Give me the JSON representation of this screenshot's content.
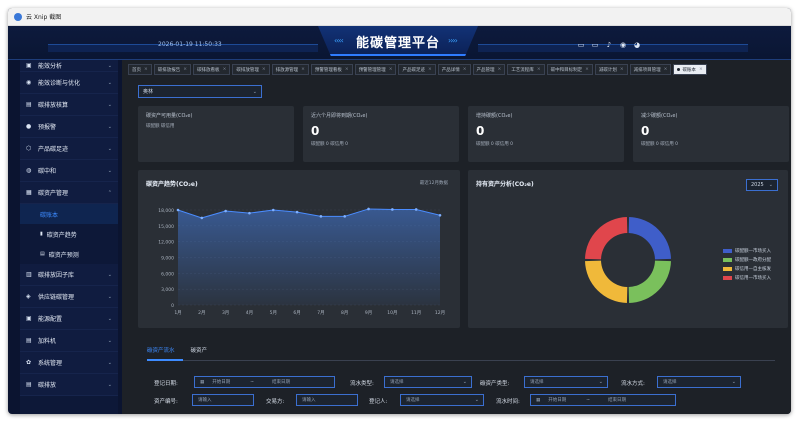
{
  "window": {
    "title": "云 Xnip 截图"
  },
  "header": {
    "date": "2026-01-19 11:50:33",
    "title": "能碳管理平台",
    "left_arrows": "‹‹‹‹",
    "right_arrows": "››››"
  },
  "header_icons": [
    "monitor-icon",
    "desktop-icon",
    "bell-icon",
    "badge-icon",
    "avatar"
  ],
  "sidebar": {
    "items": [
      {
        "label": "能效分析",
        "icon": "▣",
        "chev": "⌄"
      },
      {
        "label": "能效诊断与优化",
        "icon": "◉",
        "chev": "⌄"
      },
      {
        "label": "碳排放核算",
        "icon": "▤",
        "chev": "⌄"
      },
      {
        "label": "预报警",
        "icon": "●",
        "chev": "⌄"
      },
      {
        "label": "产品碳足迹",
        "icon": "⬡",
        "chev": "⌄"
      },
      {
        "label": "碳中和",
        "icon": "◍",
        "chev": "⌄"
      },
      {
        "label": "碳资产管理",
        "icon": "▦",
        "chev": "⌃"
      }
    ],
    "subitems": [
      {
        "label": "碳账本",
        "icon": ""
      },
      {
        "label": "碳资产趋势",
        "icon": "▮"
      },
      {
        "label": "碳资产预测",
        "icon": "▤"
      }
    ],
    "items_after": [
      {
        "label": "碳排放因子库",
        "icon": "▥",
        "chev": "⌄"
      },
      {
        "label": "供应链碳管理",
        "icon": "◈",
        "chev": "⌄"
      },
      {
        "label": "能源配置",
        "icon": "▣",
        "chev": "⌄"
      },
      {
        "label": "加料机",
        "icon": "▤",
        "chev": "⌄"
      },
      {
        "label": "系统管理",
        "icon": "✿",
        "chev": "⌄"
      },
      {
        "label": "碳排放",
        "icon": "▤",
        "chev": "⌄"
      }
    ]
  },
  "tabs": [
    {
      "label": "首页"
    },
    {
      "label": "碳排放报告"
    },
    {
      "label": "碳排放看板"
    },
    {
      "label": "碳排放管理"
    },
    {
      "label": "排放源管理"
    },
    {
      "label": "预警管理看板"
    },
    {
      "label": "预警管理管理"
    },
    {
      "label": "产品碳足迹"
    },
    {
      "label": "产品详情"
    },
    {
      "label": "产品管理"
    },
    {
      "label": "工艺流程库"
    },
    {
      "label": "碳中和目标制定"
    },
    {
      "label": "减碳计划"
    },
    {
      "label": "减排项目管理"
    },
    {
      "label": "碳账本",
      "active": true
    }
  ],
  "company_select": {
    "value": "奥林"
  },
  "cards": [
    {
      "label": "碳资产可用量(CO₂e)",
      "value": "",
      "sub": "碳配额    碳信用"
    },
    {
      "label": "近六个月即将到期(CO₂e)",
      "value": "0",
      "sub": "碳配额 0    碳信用 0"
    },
    {
      "label": "增持碳额(CO₂e)",
      "value": "0",
      "sub": "碳配额 0    碳信用 0"
    },
    {
      "label": "减少碳额(CO₂e)",
      "value": "0",
      "sub": "碳配额 0    碳信用 0"
    }
  ],
  "trend_panel": {
    "title": "碳资产趋势(CO₂e)",
    "subtitle": "最近12月数据"
  },
  "pie_panel": {
    "title": "持有资产分析(CO₂e)",
    "year": "2025"
  },
  "chart_data": [
    {
      "type": "area",
      "x": [
        "1月",
        "2月",
        "3月",
        "4月",
        "5月",
        "6月",
        "7月",
        "8月",
        "9月",
        "10月",
        "11月",
        "12月"
      ],
      "series": [
        {
          "values": [
            18000,
            16500,
            17800,
            17400,
            18000,
            17600,
            16800,
            16800,
            18200,
            18100,
            18100,
            17000
          ]
        }
      ],
      "yticks": [
        "0",
        "3,000",
        "6,000",
        "9,000",
        "12,000",
        "15,000",
        "18,000"
      ],
      "ylim": [
        0,
        18000
      ],
      "grid": true,
      "color": "#4a8cff"
    },
    {
      "type": "pie",
      "slices": [
        {
          "name": "碳配额—市场买入",
          "value": 25,
          "color": "#3f5ec9"
        },
        {
          "name": "碳配额—政府分配",
          "value": 25,
          "color": "#7ac05c"
        },
        {
          "name": "碳信用—自主核发",
          "value": 25,
          "color": "#f0b93a"
        },
        {
          "name": "碳信用—市场买入",
          "value": 25,
          "color": "#e0464c"
        }
      ],
      "legend": "right"
    }
  ],
  "bottom_tabs": [
    {
      "label": "碳资产流水",
      "active": true
    },
    {
      "label": "碳资产"
    }
  ],
  "form": {
    "reg_date_label": "登记日期:",
    "start_date": "开始日期",
    "tilde": "~",
    "end_date": "结束日期",
    "flow_type_label": "流水类型:",
    "flow_type_ph": "请选择",
    "asset_type_label": "碳资产类型:",
    "asset_type_ph": "请选择",
    "flow_mode_label": "流水方式:",
    "flow_mode_ph": "请选择",
    "asset_no_label": "资产编号:",
    "asset_no_ph": "请输入",
    "counterparty_label": "交易方:",
    "counterparty_ph": "请输入",
    "registrar_label": "登记人:",
    "registrar_ph": "请选择",
    "flow_time_label": "流水时间:",
    "start_date2": "开始日期",
    "end_date2": "结束日期"
  }
}
